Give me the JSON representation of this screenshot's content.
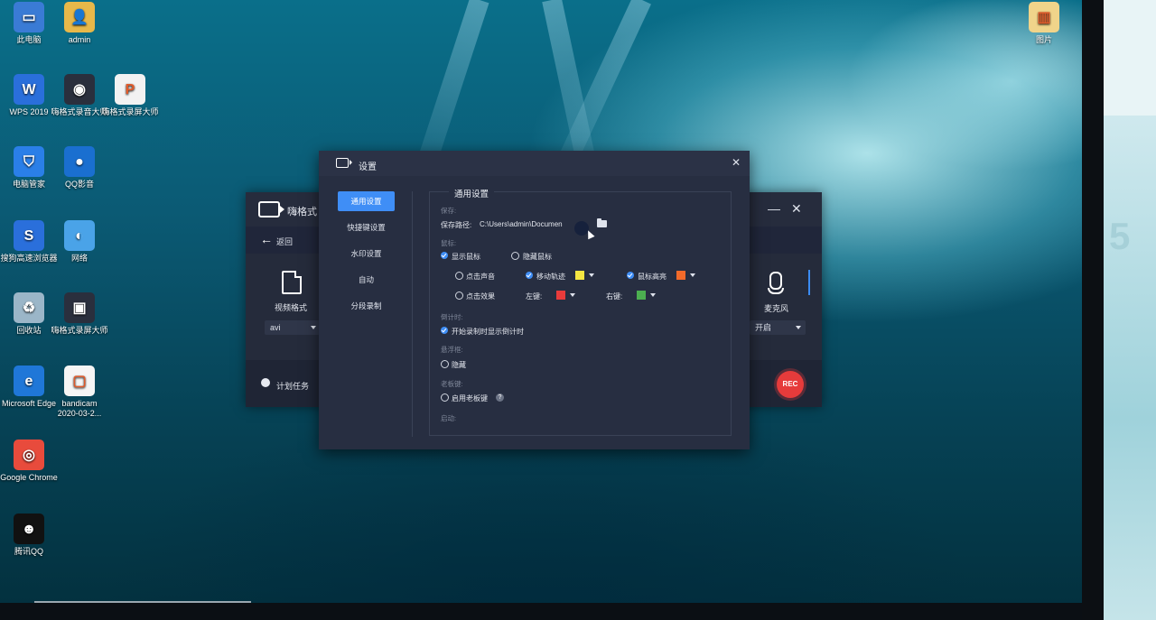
{
  "desktop": {
    "icons": [
      {
        "label": "此电脑",
        "icon": "computer-icon",
        "color": "#3a7bd5"
      },
      {
        "label": "admin",
        "icon": "user-folder-icon",
        "color": "#e8b84a"
      },
      {
        "label": "WPS 2019",
        "icon": "wps-icon",
        "color": "#2a6fdb"
      },
      {
        "label": "嗨格式录音大师",
        "icon": "audio-recorder-icon",
        "color": "#2a2f3d"
      },
      {
        "label": "嗨格式录屏大师",
        "icon": "document-icon",
        "color": "#f2f2f2"
      },
      {
        "label": "电脑管家",
        "icon": "shield-icon",
        "color": "#2a7fe8"
      },
      {
        "label": "QQ影音",
        "icon": "media-player-icon",
        "color": "#1a6fd0"
      },
      {
        "label": "搜狗高速浏览器",
        "icon": "sogou-browser-icon",
        "color": "#2a6fdb"
      },
      {
        "label": "网络",
        "icon": "network-icon",
        "color": "#4aa3e8"
      },
      {
        "label": "回收站",
        "icon": "recycle-bin-icon",
        "color": "#9bb6c8"
      },
      {
        "label": "嗨格式录屏大师",
        "icon": "screen-recorder-icon",
        "color": "#2a2f3d"
      },
      {
        "label": "Microsoft Edge",
        "icon": "edge-icon",
        "color": "#1f77d8"
      },
      {
        "label": "bandicam 2020-03-2...",
        "icon": "image-file-icon",
        "color": "#f5f5f5"
      },
      {
        "label": "Google Chrome",
        "icon": "chrome-icon",
        "color": "#e84b3c"
      },
      {
        "label": "腾讯QQ",
        "icon": "qq-icon",
        "color": "#111111"
      },
      {
        "label": "图片",
        "icon": "book-icon",
        "color": "#f0d48a"
      }
    ]
  },
  "recorder": {
    "title": "嗨格式",
    "back_label": "返回",
    "format_label": "视频格式",
    "format_value": "avi",
    "mic_label": "麦克风",
    "mic_value": "开启",
    "schedule_label": "计划任务",
    "rec_label": "REC"
  },
  "settings": {
    "title": "设置",
    "close": "✕",
    "sidebar": [
      "通用设置",
      "快捷键设置",
      "水印设置",
      "自动",
      "分段录制"
    ],
    "panel_title": "通用设置",
    "save_group": "保存:",
    "save_path_label": "保存路径:",
    "save_path_value": "C:\\Users\\admin\\Documen",
    "mouse_group": "鼠标:",
    "show_mouse": "显示鼠标",
    "hide_mouse": "隐藏鼠标",
    "click_sound": "点击声音",
    "move_track": "移动轨迹",
    "mouse_highlight": "鼠标高亮",
    "click_effect": "点击效果",
    "left_key": "左键:",
    "right_key": "右键:",
    "countdown_group": "倒计时:",
    "countdown_option": "开始录制时显示倒计时",
    "floating_group": "悬浮框:",
    "hide_option": "隐藏",
    "boss_group": "老板键:",
    "boss_option": "启用老板键",
    "auto_group": "启动:",
    "colors": {
      "move_track": "#f5e642",
      "mouse_highlight": "#f26a2a",
      "left_key": "#e83b3b",
      "right_key": "#4caf50",
      "accent": "#3f8ef6"
    }
  }
}
